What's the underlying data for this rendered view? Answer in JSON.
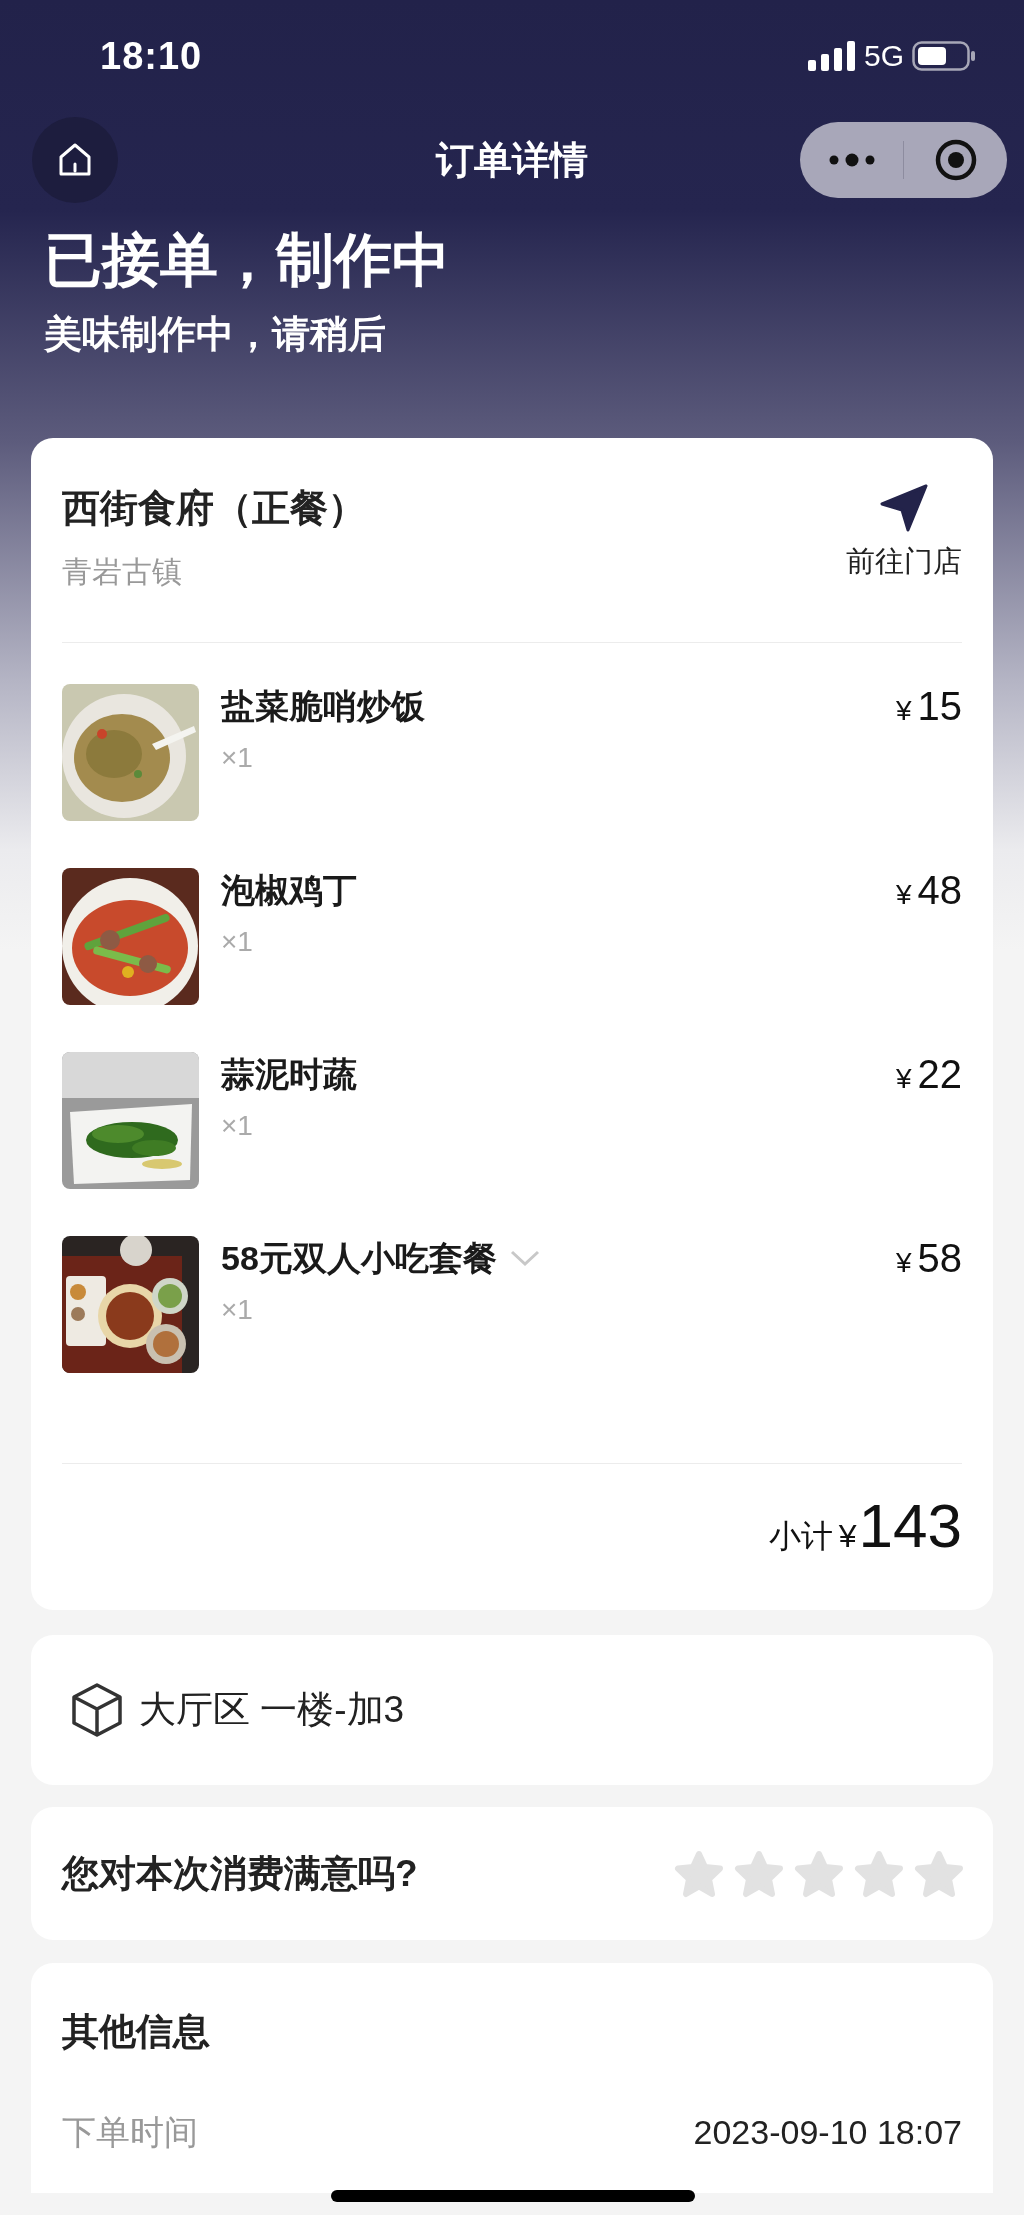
{
  "status_bar": {
    "time": "18:10",
    "network": "5G"
  },
  "nav": {
    "title": "订单详情"
  },
  "order_status": {
    "title": "已接单，制作中",
    "subtitle": "美味制作中，请稍后"
  },
  "store": {
    "name": "西街食府（正餐）",
    "location": "青岩古镇",
    "navigate_label": "前往门店"
  },
  "items": [
    {
      "name": "盐菜脆哨炒饭",
      "quantity": "×1",
      "currency": "¥",
      "amount": "15",
      "expandable": false
    },
    {
      "name": "泡椒鸡丁",
      "quantity": "×1",
      "currency": "¥",
      "amount": "48",
      "expandable": false
    },
    {
      "name": "蒜泥时蔬",
      "quantity": "×1",
      "currency": "¥",
      "amount": "22",
      "expandable": false
    },
    {
      "name": "58元双人小吃套餐",
      "quantity": "×1",
      "currency": "¥",
      "amount": "58",
      "expandable": true
    }
  ],
  "subtotal": {
    "label": "小计",
    "currency": "¥",
    "amount": "143"
  },
  "table": {
    "label": "大厅区 一楼-加3"
  },
  "rating": {
    "question": "您对本次消费满意吗?",
    "stars": 0
  },
  "other_info": {
    "title": "其他信息",
    "rows": [
      {
        "label": "下单时间",
        "value": "2023-09-10 18:07"
      }
    ]
  }
}
